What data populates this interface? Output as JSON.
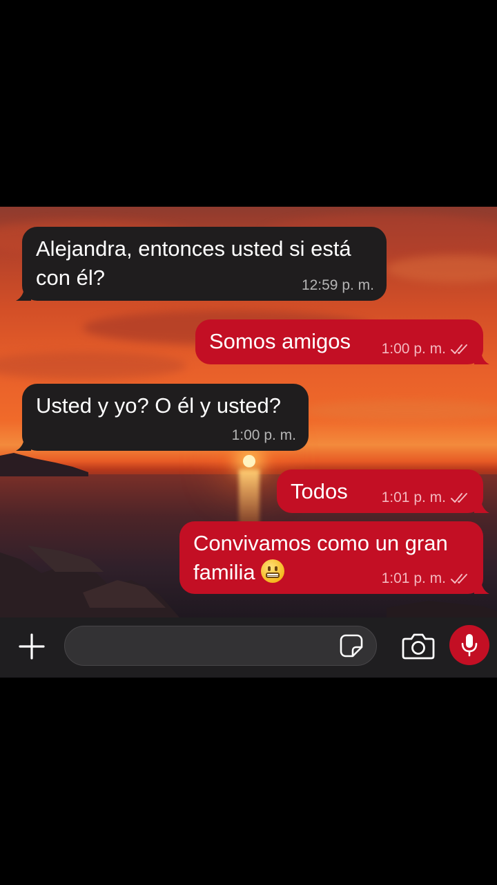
{
  "chat": {
    "messages": [
      {
        "direction": "incoming",
        "lines": [
          "Alejandra, entonces usted si está",
          "con él?"
        ],
        "time": "12:59 p. m."
      },
      {
        "direction": "outgoing",
        "lines": [
          "Somos amigos"
        ],
        "time": "1:00 p. m.",
        "status": "read-double-check"
      },
      {
        "direction": "incoming",
        "lines": [
          "Usted y yo? O él y usted?"
        ],
        "time": "1:00 p. m."
      },
      {
        "direction": "outgoing",
        "lines": [
          "Todos"
        ],
        "time": "1:01 p. m.",
        "status": "read-double-check"
      },
      {
        "direction": "outgoing",
        "lines": [
          "Convivamos como un gran",
          "familia"
        ],
        "emoji": "grimacing-face",
        "time": "1:01 p. m.",
        "status": "read-double-check"
      }
    ]
  },
  "composer": {
    "placeholder": "",
    "icons": [
      "plus-icon",
      "sticker-icon",
      "camera-icon",
      "microphone-icon"
    ]
  },
  "colors": {
    "incoming_bubble": "#1f1d1e",
    "outgoing_bubble": "#c30f24",
    "input_bar": "#1f1e20",
    "mic_button": "#c30f24"
  }
}
